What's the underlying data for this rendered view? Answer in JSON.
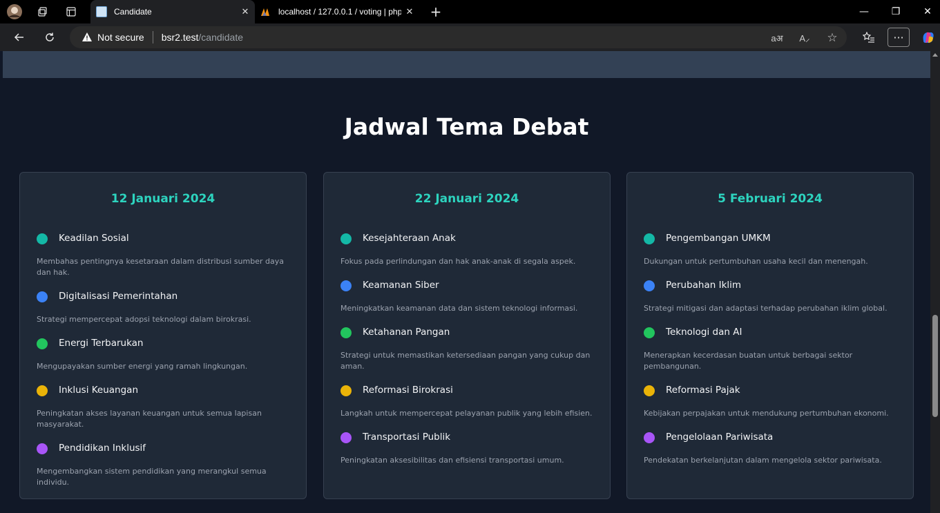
{
  "browser": {
    "tabs": [
      {
        "title": "Candidate",
        "active": true
      },
      {
        "title": "localhost / 127.0.0.1 / voting | php",
        "active": false
      }
    ],
    "address": {
      "security_label": "Not secure",
      "host": "bsr2.test",
      "path": "/candidate"
    },
    "icons": {
      "profile": "avatar-icon",
      "workspaces": "workspaces-icon",
      "tab_actions": "tab-actions-icon",
      "new_tab": "+",
      "minimize": "—",
      "restore": "❐",
      "close": "✕"
    }
  },
  "page": {
    "section_title": "Jadwal Tema Debat",
    "colors": {
      "accent": "#2dd4bf",
      "teal": "#14b8a6",
      "blue": "#3b82f6",
      "green": "#22c55e",
      "yellow": "#eab308",
      "purple": "#a855f7"
    },
    "cards": [
      {
        "date": "12 Januari 2024",
        "topics": [
          {
            "name": "Keadilan Sosial",
            "desc": "Membahas pentingnya kesetaraan dalam distribusi sumber daya dan hak.",
            "color": "#14b8a6"
          },
          {
            "name": "Digitalisasi Pemerintahan",
            "desc": "Strategi mempercepat adopsi teknologi dalam birokrasi.",
            "color": "#3b82f6"
          },
          {
            "name": "Energi Terbarukan",
            "desc": "Mengupayakan sumber energi yang ramah lingkungan.",
            "color": "#22c55e"
          },
          {
            "name": "Inklusi Keuangan",
            "desc": "Peningkatan akses layanan keuangan untuk semua lapisan masyarakat.",
            "color": "#eab308"
          },
          {
            "name": "Pendidikan Inklusif",
            "desc": "Mengembangkan sistem pendidikan yang merangkul semua individu.",
            "color": "#a855f7"
          }
        ]
      },
      {
        "date": "22 Januari 2024",
        "topics": [
          {
            "name": "Kesejahteraan Anak",
            "desc": "Fokus pada perlindungan dan hak anak-anak di segala aspek.",
            "color": "#14b8a6"
          },
          {
            "name": "Keamanan Siber",
            "desc": "Meningkatkan keamanan data dan sistem teknologi informasi.",
            "color": "#3b82f6"
          },
          {
            "name": "Ketahanan Pangan",
            "desc": "Strategi untuk memastikan ketersediaan pangan yang cukup dan aman.",
            "color": "#22c55e"
          },
          {
            "name": "Reformasi Birokrasi",
            "desc": "Langkah untuk mempercepat pelayanan publik yang lebih efisien.",
            "color": "#eab308"
          },
          {
            "name": "Transportasi Publik",
            "desc": "Peningkatan aksesibilitas dan efisiensi transportasi umum.",
            "color": "#a855f7"
          }
        ]
      },
      {
        "date": "5 Februari 2024",
        "topics": [
          {
            "name": "Pengembangan UMKM",
            "desc": "Dukungan untuk pertumbuhan usaha kecil dan menengah.",
            "color": "#14b8a6"
          },
          {
            "name": "Perubahan Iklim",
            "desc": "Strategi mitigasi dan adaptasi terhadap perubahan iklim global.",
            "color": "#3b82f6"
          },
          {
            "name": "Teknologi dan AI",
            "desc": "Menerapkan kecerdasan buatan untuk berbagai sektor pembangunan.",
            "color": "#22c55e"
          },
          {
            "name": "Reformasi Pajak",
            "desc": "Kebijakan perpajakan untuk mendukung pertumbuhan ekonomi.",
            "color": "#eab308"
          },
          {
            "name": "Pengelolaan Pariwisata",
            "desc": "Pendekatan berkelanjutan dalam mengelola sektor pariwisata.",
            "color": "#a855f7"
          }
        ]
      }
    ]
  }
}
